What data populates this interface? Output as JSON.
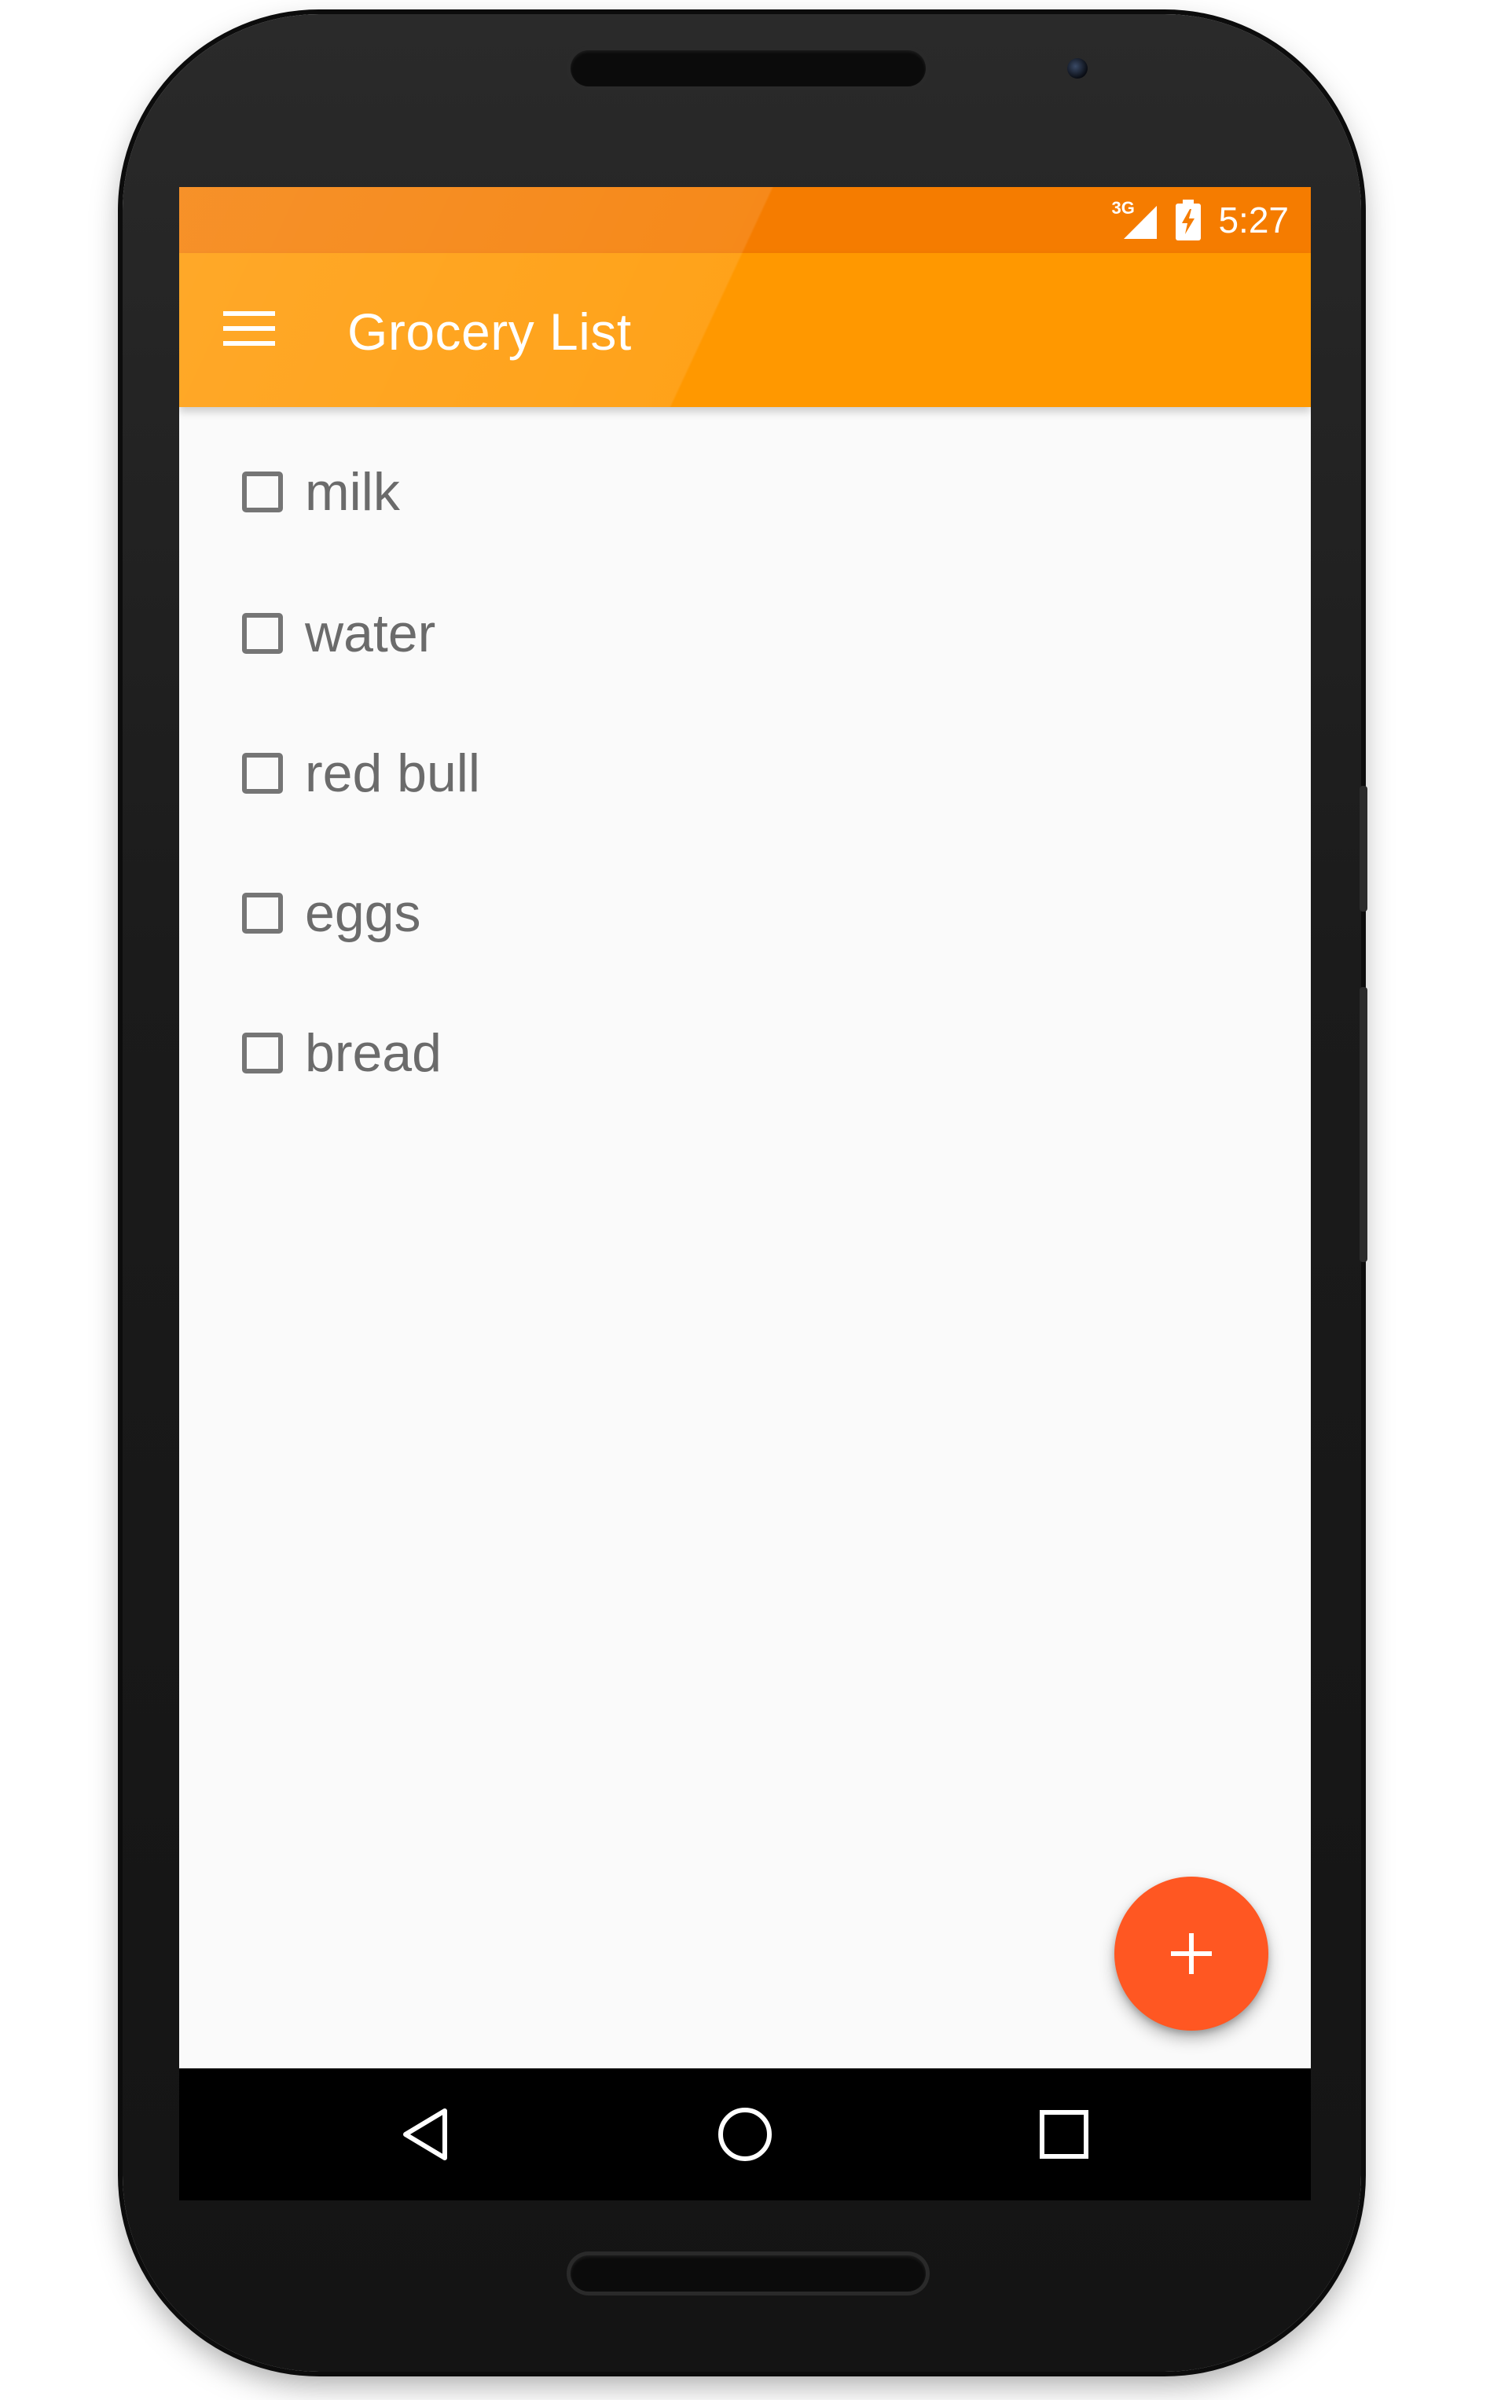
{
  "status_bar": {
    "network": "3G",
    "time": "5:27",
    "icons": [
      "signal-icon",
      "battery-charging-icon"
    ]
  },
  "app_bar": {
    "menu_icon": "menu-icon",
    "title": "Grocery List"
  },
  "list": {
    "items": [
      {
        "label": "milk",
        "checked": false
      },
      {
        "label": "water",
        "checked": false
      },
      {
        "label": "red bull",
        "checked": false
      },
      {
        "label": "eggs",
        "checked": false
      },
      {
        "label": "bread",
        "checked": false
      }
    ]
  },
  "fab": {
    "icon": "plus-icon"
  },
  "nav_bar": {
    "buttons": [
      "back-icon",
      "home-icon",
      "recents-icon"
    ]
  },
  "colors": {
    "status_bar": "#f57c00",
    "app_bar": "#ff9800",
    "fab": "#ff5722",
    "background": "#fafafa",
    "item_text": "#6b6b6b"
  }
}
